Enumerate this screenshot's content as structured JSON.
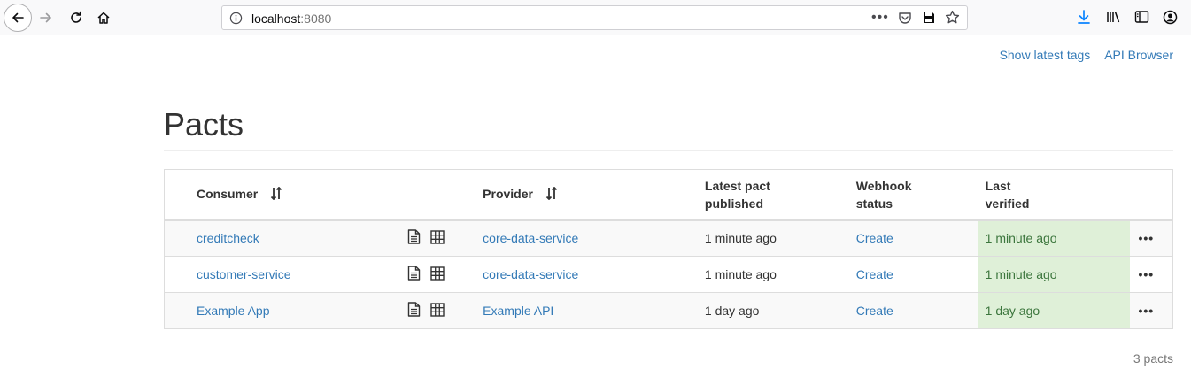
{
  "browser": {
    "url_host": "localhost",
    "url_port": ":8080",
    "url_more": "•••"
  },
  "header_links": {
    "show_latest_tags": "Show latest tags",
    "api_browser": "API Browser"
  },
  "page": {
    "title": "Pacts"
  },
  "table": {
    "headers": {
      "consumer": "Consumer",
      "provider": "Provider",
      "latest_pact_1": "Latest pact",
      "latest_pact_2": "published",
      "webhook_1": "Webhook",
      "webhook_2": "status",
      "last_verified_1": "Last",
      "last_verified_2": "verified"
    },
    "rows": [
      {
        "consumer": "creditcheck",
        "provider": "core-data-service",
        "published": "1 minute ago",
        "webhook": "Create",
        "verified": "1 minute ago",
        "menu": "•••"
      },
      {
        "consumer": "customer-service",
        "provider": "core-data-service",
        "published": "1 minute ago",
        "webhook": "Create",
        "verified": "1 minute ago",
        "menu": "•••"
      },
      {
        "consumer": "Example App",
        "provider": "Example API",
        "published": "1 day ago",
        "webhook": "Create",
        "verified": "1 day ago",
        "menu": "•••"
      }
    ]
  },
  "footer": {
    "count": "3 pacts"
  },
  "colors": {
    "link": "#337ab7",
    "verified_bg": "#dff0d8",
    "verified_text": "#3c763d"
  }
}
